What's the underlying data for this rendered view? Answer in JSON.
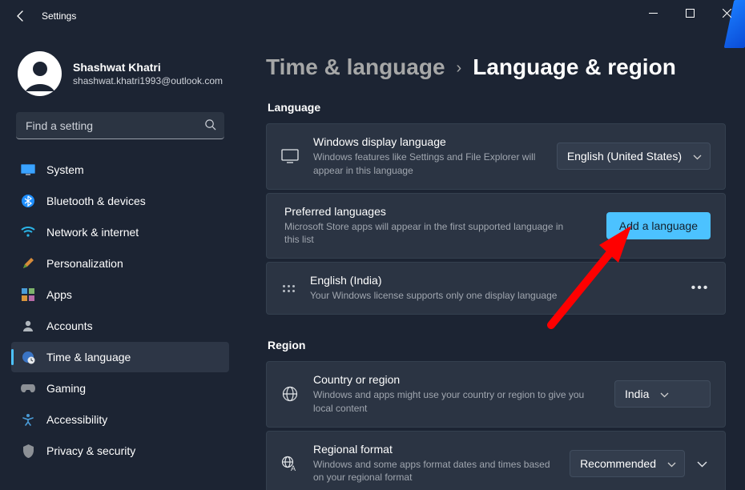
{
  "window": {
    "title": "Settings"
  },
  "profile": {
    "name": "Shashwat Khatri",
    "email": "shashwat.khatri1993@outlook.com"
  },
  "search": {
    "placeholder": "Find a setting"
  },
  "sidebar": {
    "items": [
      {
        "label": "System"
      },
      {
        "label": "Bluetooth & devices"
      },
      {
        "label": "Network & internet"
      },
      {
        "label": "Personalization"
      },
      {
        "label": "Apps"
      },
      {
        "label": "Accounts"
      },
      {
        "label": "Time & language"
      },
      {
        "label": "Gaming"
      },
      {
        "label": "Accessibility"
      },
      {
        "label": "Privacy & security"
      }
    ],
    "selected_index": 6
  },
  "breadcrumb": {
    "parent": "Time & language",
    "current": "Language & region"
  },
  "sections": {
    "language_label": "Language",
    "region_label": "Region"
  },
  "cards": {
    "display_lang": {
      "title": "Windows display language",
      "subtitle": "Windows features like Settings and File Explorer will appear in this language",
      "value": "English (United States)"
    },
    "preferred": {
      "title": "Preferred languages",
      "subtitle": "Microsoft Store apps will appear in the first supported language in this list",
      "button": "Add a language"
    },
    "lang_entry": {
      "title": "English (India)",
      "subtitle": "Your Windows license supports only one display language"
    },
    "country": {
      "title": "Country or region",
      "subtitle": "Windows and apps might use your country or region to give you local content",
      "value": "India"
    },
    "regional_format": {
      "title": "Regional format",
      "subtitle": "Windows and some apps format dates and times based on your regional format",
      "value": "Recommended"
    }
  },
  "colors": {
    "accent": "#4cc2ff",
    "annotation": "#ff0000"
  }
}
